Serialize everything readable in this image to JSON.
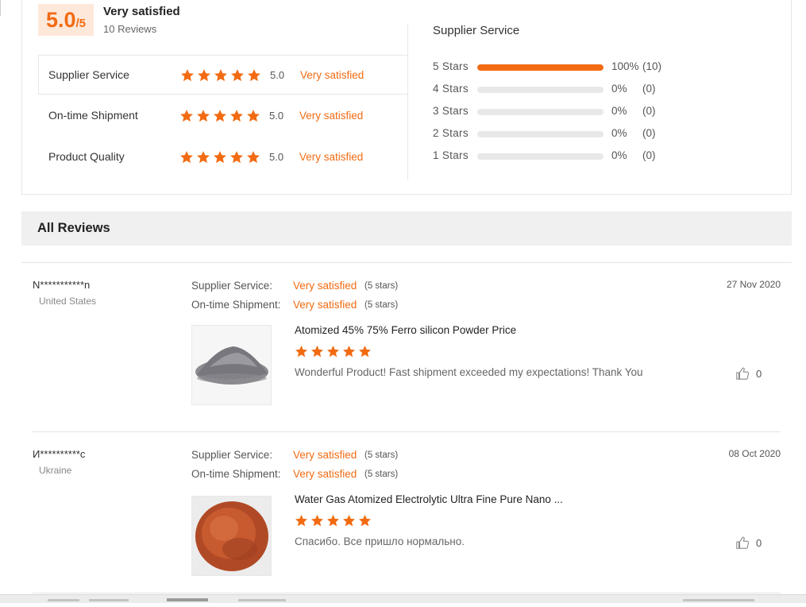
{
  "summary": {
    "score": "5.0",
    "score_max": "/5",
    "label": "Very satisfied",
    "reviews_count": "10 Reviews"
  },
  "categories": [
    {
      "name": "Supplier Service",
      "score": "5.0",
      "desc": "Very satisfied",
      "stars": 5,
      "active": true
    },
    {
      "name": "On-time Shipment",
      "score": "5.0",
      "desc": "Very satisfied",
      "stars": 5,
      "active": false
    },
    {
      "name": "Product Quality",
      "score": "5.0",
      "desc": "Very satisfied",
      "stars": 5,
      "active": false
    }
  ],
  "distribution": {
    "title": "Supplier Service",
    "rows": [
      {
        "label": "5  Stars",
        "pct": "100%",
        "count": "(10)",
        "fill": 1.0
      },
      {
        "label": "4  Stars",
        "pct": "0%",
        "count": "(0)",
        "fill": 0
      },
      {
        "label": "3  Stars",
        "pct": "0%",
        "count": "(0)",
        "fill": 0
      },
      {
        "label": "2  Stars",
        "pct": "0%",
        "count": "(0)",
        "fill": 0
      },
      {
        "label": "1  Stars",
        "pct": "0%",
        "count": "(0)",
        "fill": 0
      }
    ]
  },
  "all_reviews": {
    "title": "All Reviews"
  },
  "reviews": [
    {
      "user": "N***********n",
      "country": "United States",
      "date": "27 Nov 2020",
      "supplier_label": "Supplier Service:",
      "supplier_value": "Very satisfied",
      "supplier_note": "(5 stars)",
      "shipment_label": "On-time Shipment:",
      "shipment_value": "Very satisfied",
      "shipment_note": "(5 stars)",
      "product": "Atomized 45% 75% Ferro silicon Powder Price",
      "stars": 5,
      "comment": "Wonderful Product! Fast shipment exceeded my expectations! Thank You",
      "likes": "0",
      "image_color": "gray"
    },
    {
      "user": "И**********c",
      "country": "Ukraine",
      "date": "08 Oct 2020",
      "supplier_label": "Supplier Service:",
      "supplier_value": "Very satisfied",
      "supplier_note": "(5 stars)",
      "shipment_label": "On-time Shipment:",
      "shipment_value": "Very satisfied",
      "shipment_note": "(5 stars)",
      "product": "Water Gas Atomized Electrolytic Ultra Fine Pure Nano ...",
      "stars": 5,
      "comment": "Спасибо. Все пришло нормально.",
      "likes": "0",
      "image_color": "copper"
    }
  ],
  "colors": {
    "accent": "#f26b12",
    "badge_bg": "#fde8da"
  },
  "icons": [
    "star-icon",
    "thumbs-up-icon"
  ]
}
